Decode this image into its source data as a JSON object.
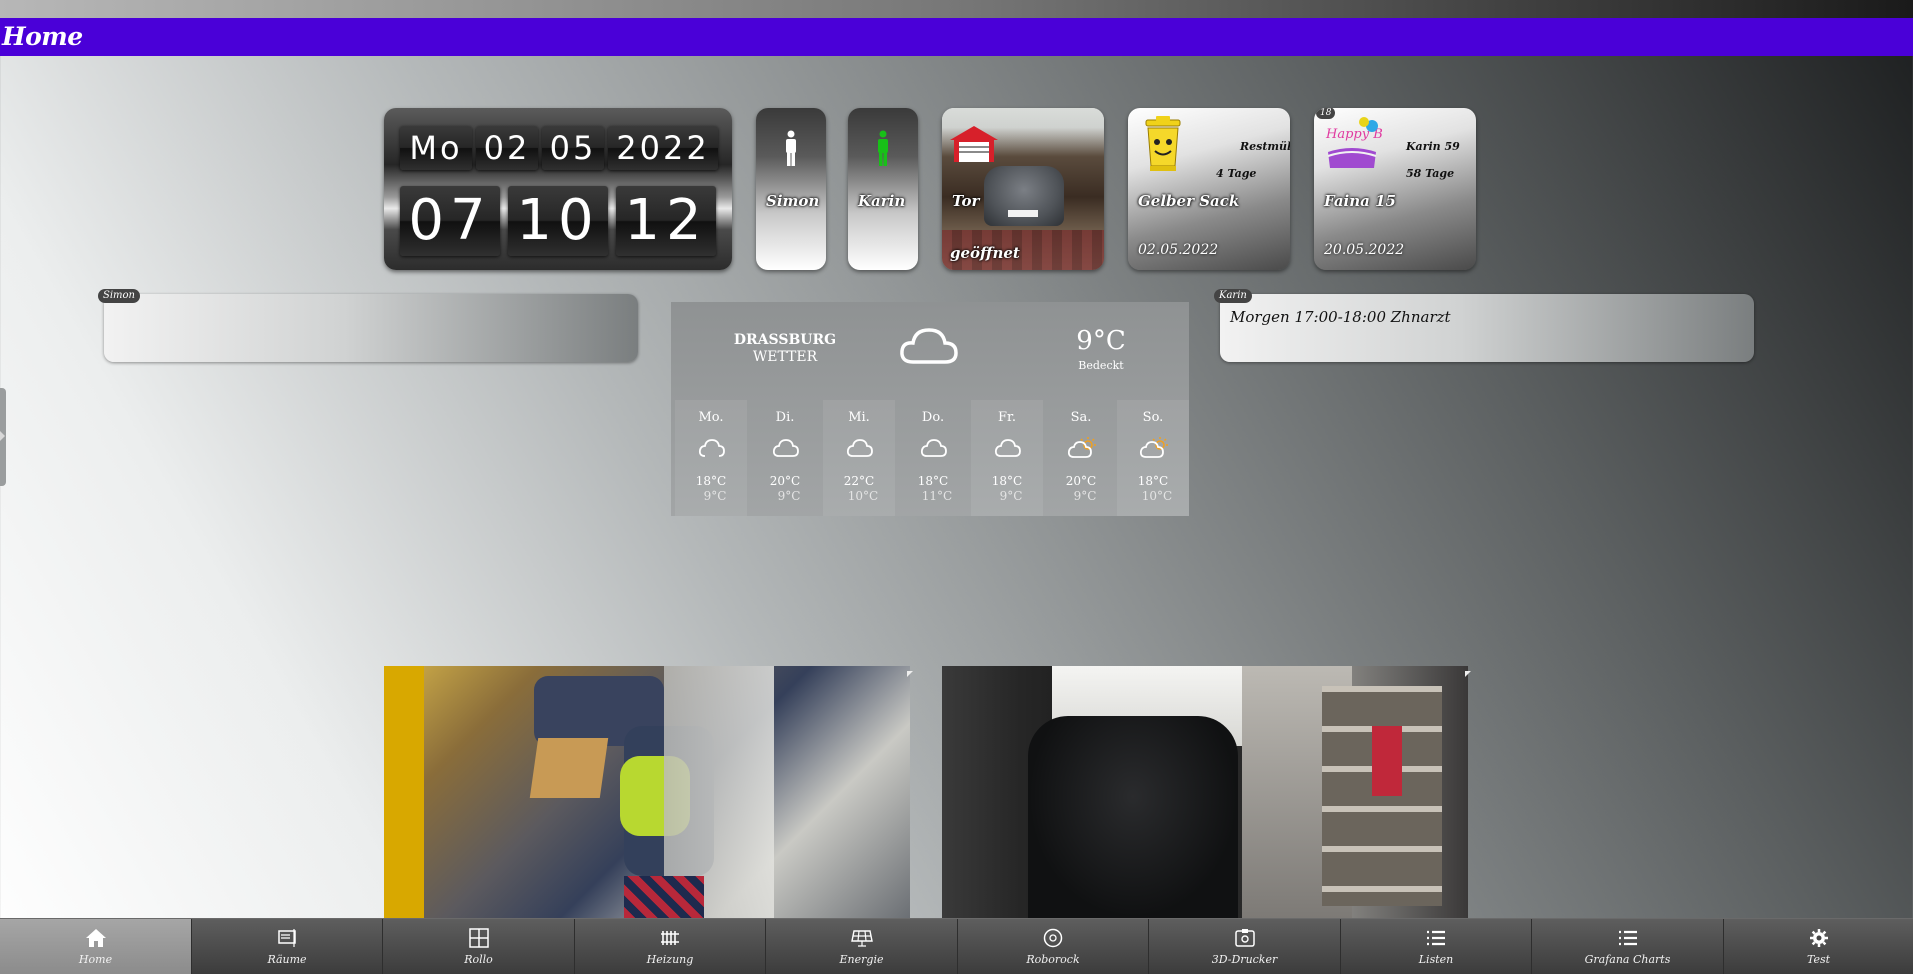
{
  "header": {
    "title": "Home"
  },
  "clock": {
    "weekday": "Mo",
    "day": "02",
    "month": "05",
    "year": "2022",
    "hour": "07",
    "minute": "10",
    "second": "12"
  },
  "presence": [
    {
      "name": "Simon",
      "status_color": "#ffffff"
    },
    {
      "name": "Karin",
      "status_color": "#18c018"
    }
  ],
  "garage": {
    "label": "Tor",
    "status": "geöffnet"
  },
  "waste": {
    "name": "Gelber Sack",
    "next": "Restmüll",
    "days": "4 Tage",
    "date": "02.05.2022"
  },
  "birthday": {
    "badge": "18",
    "name": "Faina 15",
    "next": "Karin 59",
    "days": "58 Tage",
    "date": "20.05.2022",
    "image_text": "Happy Birthday"
  },
  "panels": {
    "simon": {
      "tag": "Simon",
      "note": ""
    },
    "karin": {
      "tag": "Karin",
      "note": "Morgen 17:00-18:00 Zhnarzt"
    }
  },
  "weather": {
    "location": "DRASSBURG",
    "label": "WETTER",
    "temperature": "9°C",
    "condition": "Bedeckt",
    "forecast": [
      {
        "day": "Mo.",
        "icon": "cloud-icon",
        "hi": "18°C",
        "lo": "9°C"
      },
      {
        "day": "Di.",
        "icon": "cloud-icon",
        "hi": "20°C",
        "lo": "9°C"
      },
      {
        "day": "Mi.",
        "icon": "cloud-icon",
        "hi": "22°C",
        "lo": "10°C"
      },
      {
        "day": "Do.",
        "icon": "cloud-icon",
        "hi": "18°C",
        "lo": "11°C"
      },
      {
        "day": "Fr.",
        "icon": "cloud-icon",
        "hi": "18°C",
        "lo": "9°C"
      },
      {
        "day": "Sa.",
        "icon": "partly-sunny-icon",
        "hi": "20°C",
        "lo": "9°C"
      },
      {
        "day": "So.",
        "icon": "partly-sunny-icon",
        "hi": "18°C",
        "lo": "10°C"
      }
    ]
  },
  "nav": [
    {
      "label": "Home",
      "icon": "home-icon",
      "active": true
    },
    {
      "label": "Räume",
      "icon": "rooms-icon"
    },
    {
      "label": "Rollo",
      "icon": "window-icon"
    },
    {
      "label": "Heizung",
      "icon": "radiator-icon"
    },
    {
      "label": "Energie",
      "icon": "solar-panel-icon"
    },
    {
      "label": "Roborock",
      "icon": "robot-vacuum-icon"
    },
    {
      "label": "3D-Drucker",
      "icon": "printer-3d-icon"
    },
    {
      "label": "Listen",
      "icon": "list-icon"
    },
    {
      "label": "Grafana Charts",
      "icon": "list-icon"
    },
    {
      "label": "Test",
      "icon": "gear-icon"
    }
  ],
  "colors": {
    "header": "#4a00d8",
    "presence_home": "#18c018"
  }
}
